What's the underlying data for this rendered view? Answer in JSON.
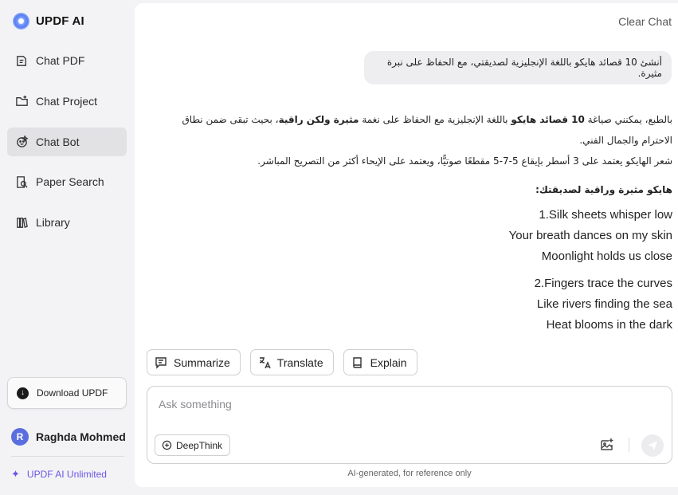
{
  "brand": {
    "name": "UPDF AI"
  },
  "sidebar": {
    "items": [
      {
        "label": "Chat PDF",
        "icon": "chat-pdf-icon"
      },
      {
        "label": "Chat Project",
        "icon": "folder-chat-icon"
      },
      {
        "label": "Chat Bot",
        "icon": "bot-icon",
        "active": true
      },
      {
        "label": "Paper Search",
        "icon": "paper-search-icon"
      },
      {
        "label": "Library",
        "icon": "library-icon"
      }
    ],
    "download_label": "Download UPDF",
    "user": {
      "initial": "R",
      "name": "Raghda Mohmed"
    },
    "plan_label": "UPDF AI Unlimited"
  },
  "chat": {
    "clear_label": "Clear Chat",
    "user_message": "أنشئ 10 قصائد هايكو باللغة الإنجليزية لصديقتي، مع الحفاظ على نبرة مثيرة.",
    "answer": {
      "intro_1": "بالطبع، يمكنني صياغة ",
      "intro_bold_1": "10 قصائد هايكو",
      "intro_2": " باللغة الإنجليزية مع الحفاظ على نغمة ",
      "intro_bold_2": "مثيرة ولكن راقية",
      "intro_3": "، بحيث تبقى ضمن نطاق الاحترام والجمال الفني.",
      "note": "شعر الهايكو يعتمد على 3 أسطر بإيقاع 5-7-5 مقطعًا صوتيًّا، ويعتمد على الإيحاء أكثر من التصريح المباشر.",
      "heading": "هايكو مثيرة وراقية لصديقتك:",
      "poems": [
        {
          "lines": [
            "1.Silk sheets whisper low",
            "Your breath dances on my skin",
            "Moonlight holds us close"
          ]
        },
        {
          "lines": [
            "2.Fingers trace the curves",
            "Like rivers finding the sea",
            "Heat blooms in the dark"
          ]
        }
      ]
    }
  },
  "actions": {
    "summarize": "Summarize",
    "translate": "Translate",
    "explain": "Explain"
  },
  "composer": {
    "placeholder": "Ask something",
    "value": "",
    "deepthink_label": "DeepThink"
  },
  "footnote": "AI-generated, for reference only",
  "colors": {
    "accent": "#6b57e6",
    "avatar": "#5a6ee0",
    "active_nav": "#e2e2e5"
  }
}
